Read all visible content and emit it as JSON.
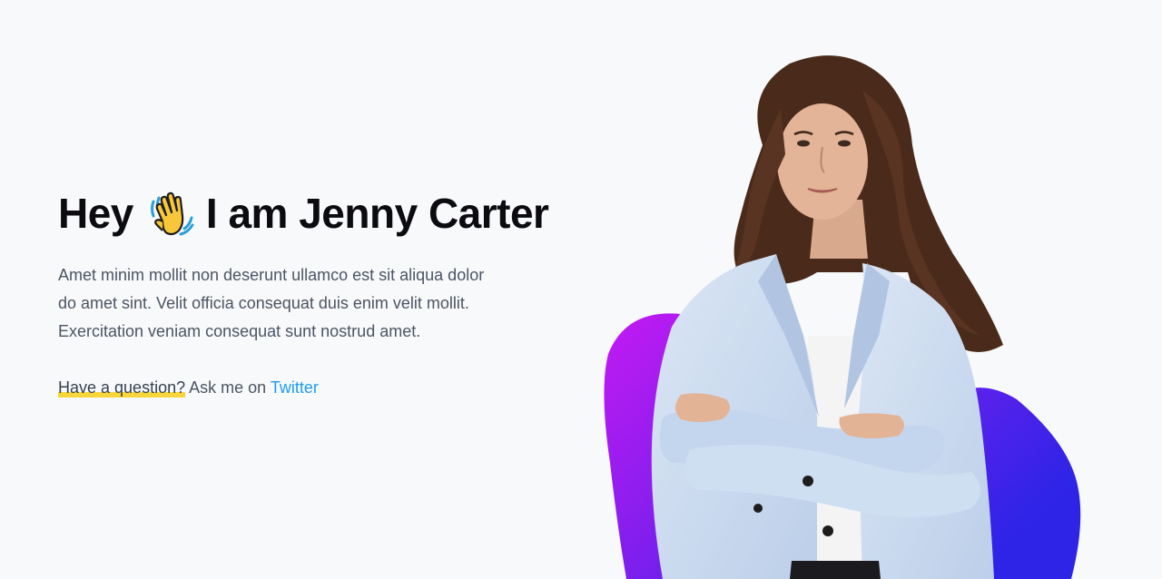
{
  "hero": {
    "title_before": "Hey",
    "title_after": "I am Jenny Carter",
    "description": "Amet minim mollit non deserunt ullamco est sit aliqua dolor do amet sint. Velit officia consequat duis enim velit mollit. Exercitation veniam consequat sunt nostrud amet.",
    "contact_highlight": "Have a question?",
    "contact_middle": " Ask me on ",
    "contact_link": "Twitter"
  },
  "icons": {
    "title_emoji": "waving-hand-icon"
  },
  "colors": {
    "background": "#f8f9fb",
    "title": "#0c0c10",
    "body_text": "#4b5563",
    "highlight": "#f7d63c",
    "link": "#1d9bf0",
    "blob_gradient_start": "#c31af2",
    "blob_gradient_end": "#2e24e8",
    "blazer": "#c9daf0"
  }
}
